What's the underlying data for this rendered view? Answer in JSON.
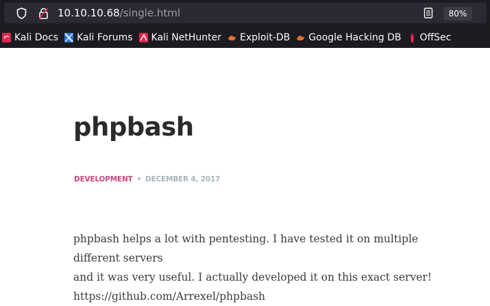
{
  "browser": {
    "url_host": "10.10.10.68",
    "url_path": "/single.html",
    "zoom_level": "80%",
    "bookmarks": [
      {
        "label": "Kali Docs",
        "icon": "kali-docs-icon"
      },
      {
        "label": "Kali Forums",
        "icon": "kali-forums-icon"
      },
      {
        "label": "Kali NetHunter",
        "icon": "kali-nethunter-icon"
      },
      {
        "label": "Exploit-DB",
        "icon": "exploit-db-icon"
      },
      {
        "label": "Google Hacking DB",
        "icon": "google-hacking-db-icon"
      },
      {
        "label": "OffSec",
        "icon": "offsec-icon"
      }
    ]
  },
  "post": {
    "title": "phpbash",
    "category": "Development",
    "separator": "•",
    "date": "December 4, 2017",
    "body_line1": "phpbash helps a lot with pentesting. I have tested it on multiple different servers",
    "body_line2": "and it was very useful. I actually developed it on this exact server!",
    "body_line3": "https://github.com/Arrexel/phpbash"
  },
  "colors": {
    "chrome_bg": "#1c1b22",
    "urlbar_bg": "#2b2a33",
    "category": "#c9477d",
    "date": "#a9b4b8",
    "title": "#2b2b2b"
  }
}
